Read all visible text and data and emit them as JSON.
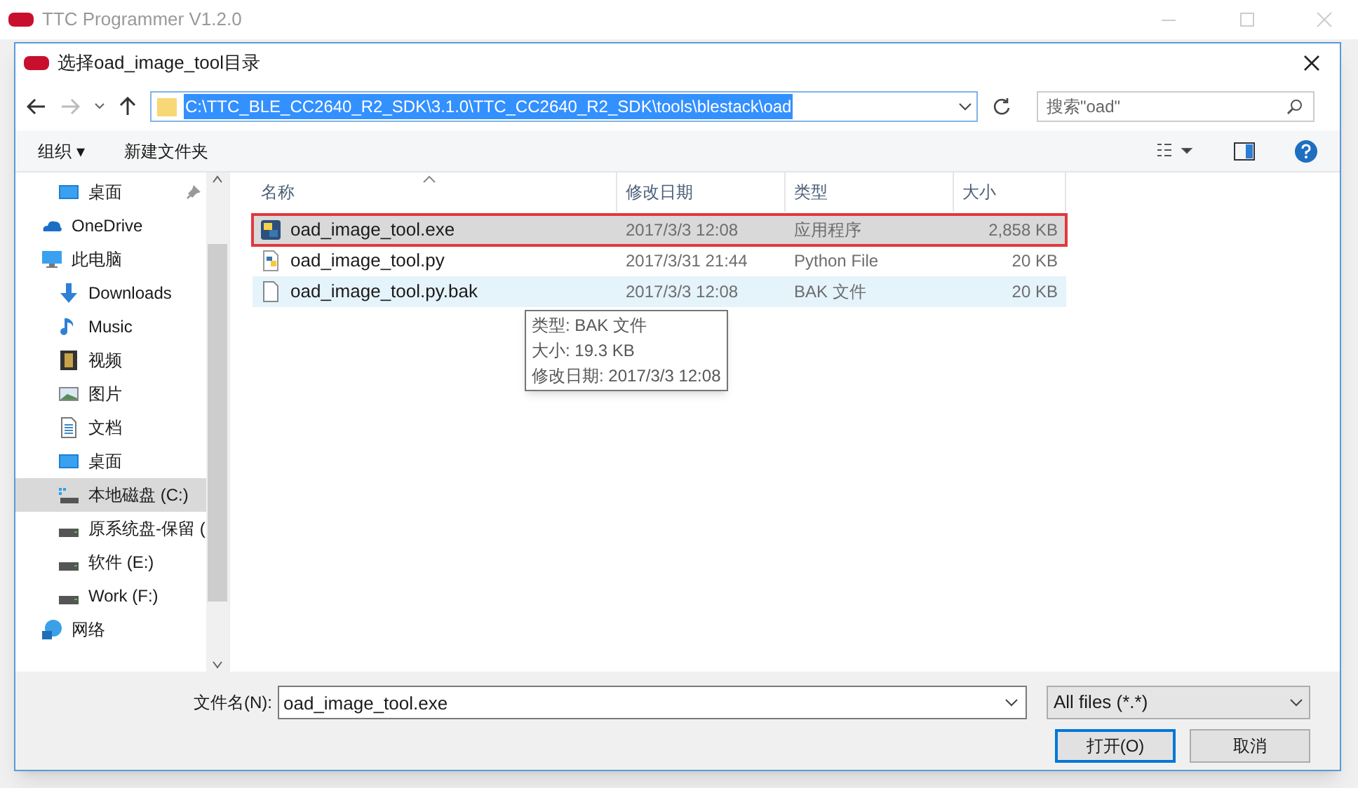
{
  "app_window": {
    "title": "TTC Programmer V1.2.0"
  },
  "dialog": {
    "title": "选择oad_image_tool目录"
  },
  "address_bar": {
    "path": "C:\\TTC_BLE_CC2640_R2_SDK\\3.1.0\\TTC_CC2640_R2_SDK\\tools\\blestack\\oad"
  },
  "search": {
    "placeholder": "搜索\"oad\""
  },
  "toolbar": {
    "organize": "组织 ▾",
    "new_folder": "新建文件夹"
  },
  "nav": [
    {
      "label": "桌面",
      "kind": "desktop",
      "pinned": true,
      "selected": false
    },
    {
      "label": "OneDrive",
      "kind": "cloud",
      "selected": false
    },
    {
      "label": "此电脑",
      "kind": "pc",
      "selected": false,
      "children": [
        {
          "label": "Downloads",
          "kind": "download",
          "selected": false
        },
        {
          "label": "Music",
          "kind": "music",
          "selected": false
        },
        {
          "label": "视频",
          "kind": "video",
          "selected": false
        },
        {
          "label": "图片",
          "kind": "image",
          "selected": false
        },
        {
          "label": "文档",
          "kind": "document",
          "selected": false
        },
        {
          "label": "桌面",
          "kind": "desktop",
          "selected": false
        },
        {
          "label": "本地磁盘 (C:)",
          "kind": "system-drive",
          "selected": true
        },
        {
          "label": "原系统盘-保留 (",
          "kind": "drive",
          "selected": false
        },
        {
          "label": "软件 (E:)",
          "kind": "drive",
          "selected": false
        },
        {
          "label": "Work (F:)",
          "kind": "drive",
          "selected": false
        }
      ]
    },
    {
      "label": "网络",
      "kind": "network",
      "selected": false
    }
  ],
  "table": {
    "columns": [
      "名称",
      "修改日期",
      "类型",
      "大小"
    ],
    "rows": [
      {
        "name": "oad_image_tool.exe",
        "date": "2017/3/3 12:08",
        "type": "应用程序",
        "size": "2,858 KB",
        "kind": "exe",
        "selected": true,
        "hovered": false,
        "outlined": true
      },
      {
        "name": "oad_image_tool.py",
        "date": "2017/3/31 21:44",
        "type": "Python File",
        "size": "20 KB",
        "kind": "python",
        "selected": false,
        "hovered": false,
        "outlined": false
      },
      {
        "name": "oad_image_tool.py.bak",
        "date": "2017/3/3 12:08",
        "type": "BAK 文件",
        "size": "20 KB",
        "kind": "blank",
        "selected": false,
        "hovered": true,
        "outlined": false
      }
    ]
  },
  "tooltip": [
    "类型: BAK 文件",
    "大小: 19.3 KB",
    "修改日期: 2017/3/3 12:08"
  ],
  "filename": {
    "label": "文件名(N):",
    "value": "oad_image_tool.exe"
  },
  "filter": {
    "value": "All files (*.*)"
  },
  "buttons": [
    "打开(O)",
    "取消"
  ]
}
